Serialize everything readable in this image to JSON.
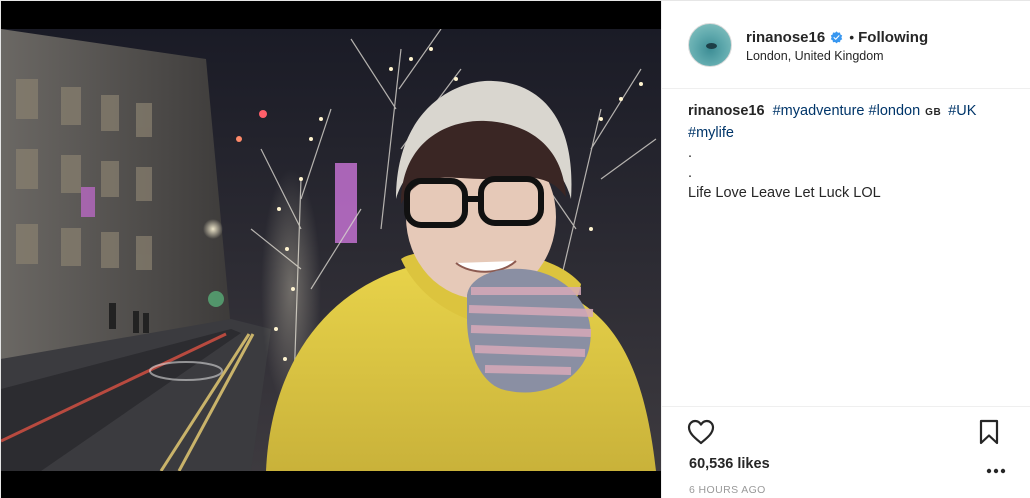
{
  "post": {
    "username": "rinanose16",
    "verified": true,
    "separator": "•",
    "follow_status": "Following",
    "location": "London, United Kingdom"
  },
  "caption": {
    "username": "rinanose16",
    "tag_1": "#myadventure",
    "tag_2": "#london",
    "flag": "GB",
    "tag_3": "#UK",
    "tag_4": "#mylife",
    "dot_1": ".",
    "dot_2": ".",
    "text": "Life Love Leave Let Luck LOL"
  },
  "actions": {
    "like_icon": "heart-outline-icon",
    "save_icon": "bookmark-outline-icon",
    "more_icon": "more-horizontal-icon"
  },
  "stats": {
    "likes": "60,536 likes",
    "timestamp": "6 HOURS AGO"
  },
  "colors": {
    "link": "#003569",
    "verified_blue": "#3897f0",
    "text": "#262626",
    "muted": "#999999",
    "divider": "#efefef"
  }
}
